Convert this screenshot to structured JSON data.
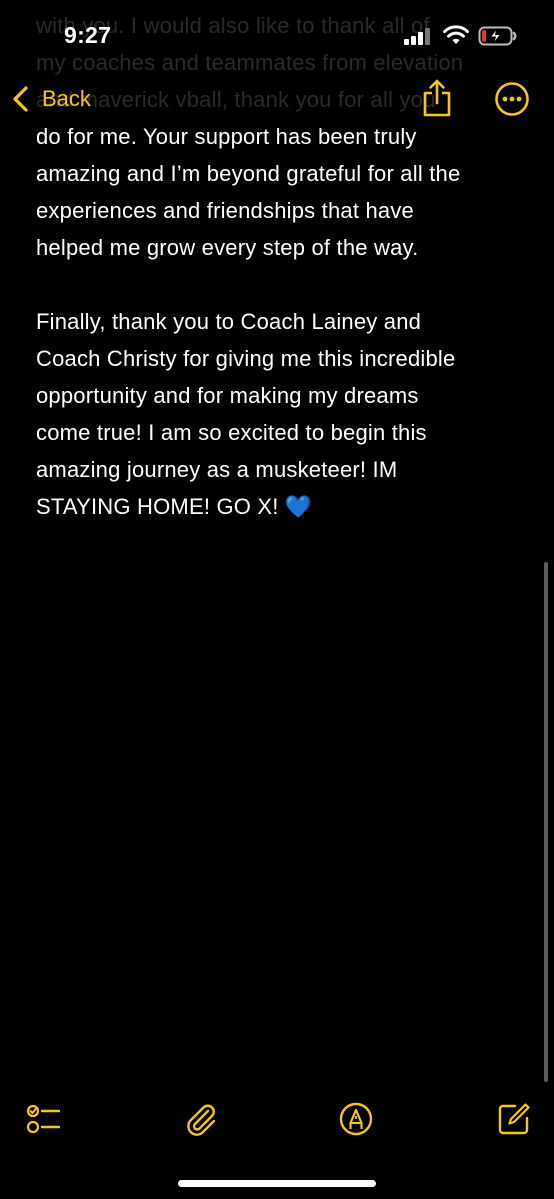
{
  "status_bar": {
    "time": "9:27"
  },
  "nav": {
    "back_label": "Back"
  },
  "note": {
    "hidden_lines": [
      "with you. I would also like to thank all of",
      "my coaches and teammates from elevation",
      "and maverick vball, thank you for all you"
    ],
    "paragraph1_lines": [
      "do for me. Your support has been truly",
      "amazing and I’m beyond grateful for all the",
      "experiences and friendships that have",
      "helped me grow every step of the way."
    ],
    "paragraph2_lines": [
      "Finally, thank you to Coach Lainey and",
      "Coach Christy for giving me this incredible",
      "opportunity and for making my dreams",
      "come true! I am so excited to begin this",
      "amazing journey as a musketeer! IM"
    ],
    "last_line_text": "STAYING HOME! GO X!",
    "last_line_emoji": "💙"
  },
  "toolbar": {
    "checklist_icon": "checklist-icon",
    "attachment_icon": "paperclip-icon",
    "markup_icon": "pen-markup-icon",
    "compose_icon": "compose-icon"
  },
  "colors": {
    "accent": "#f5c518",
    "background": "#000000",
    "text": "#ffffff",
    "heart": "#1e7cf2",
    "battery_low": "#e53935"
  }
}
